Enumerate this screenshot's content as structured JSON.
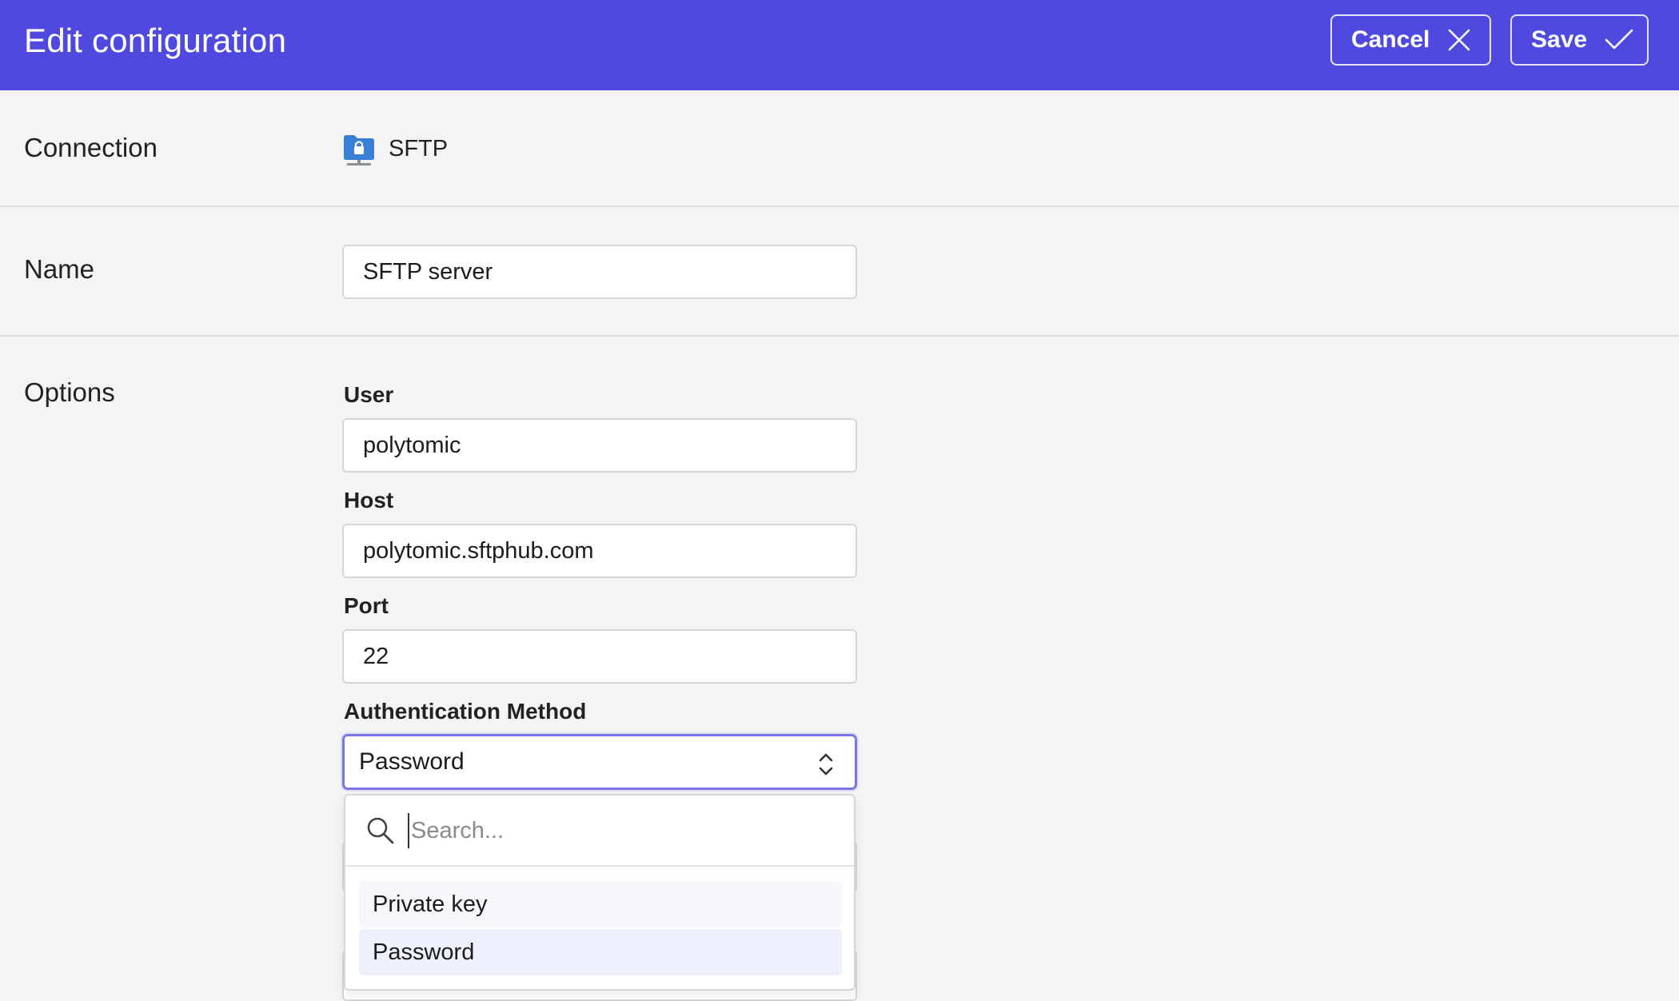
{
  "header": {
    "title": "Edit configuration",
    "cancel_label": "Cancel",
    "save_label": "Save",
    "background": "#4f49e0"
  },
  "connection": {
    "label": "Connection",
    "icon": "sftp-folder-lock-icon",
    "value": "SFTP"
  },
  "name": {
    "label": "Name",
    "value": "SFTP server"
  },
  "options": {
    "label": "Options",
    "user": {
      "label": "User",
      "value": "polytomic"
    },
    "host": {
      "label": "Host",
      "value": "polytomic.sftphub.com"
    },
    "port": {
      "label": "Port",
      "value": "22"
    },
    "auth": {
      "label": "Authentication Method",
      "selected": "Password",
      "dropdown": {
        "search_placeholder": "Search...",
        "options": [
          "Private key",
          "Password"
        ]
      }
    }
  },
  "colors": {
    "accent": "#4f49e0",
    "focus_ring": "#7b75e6"
  }
}
